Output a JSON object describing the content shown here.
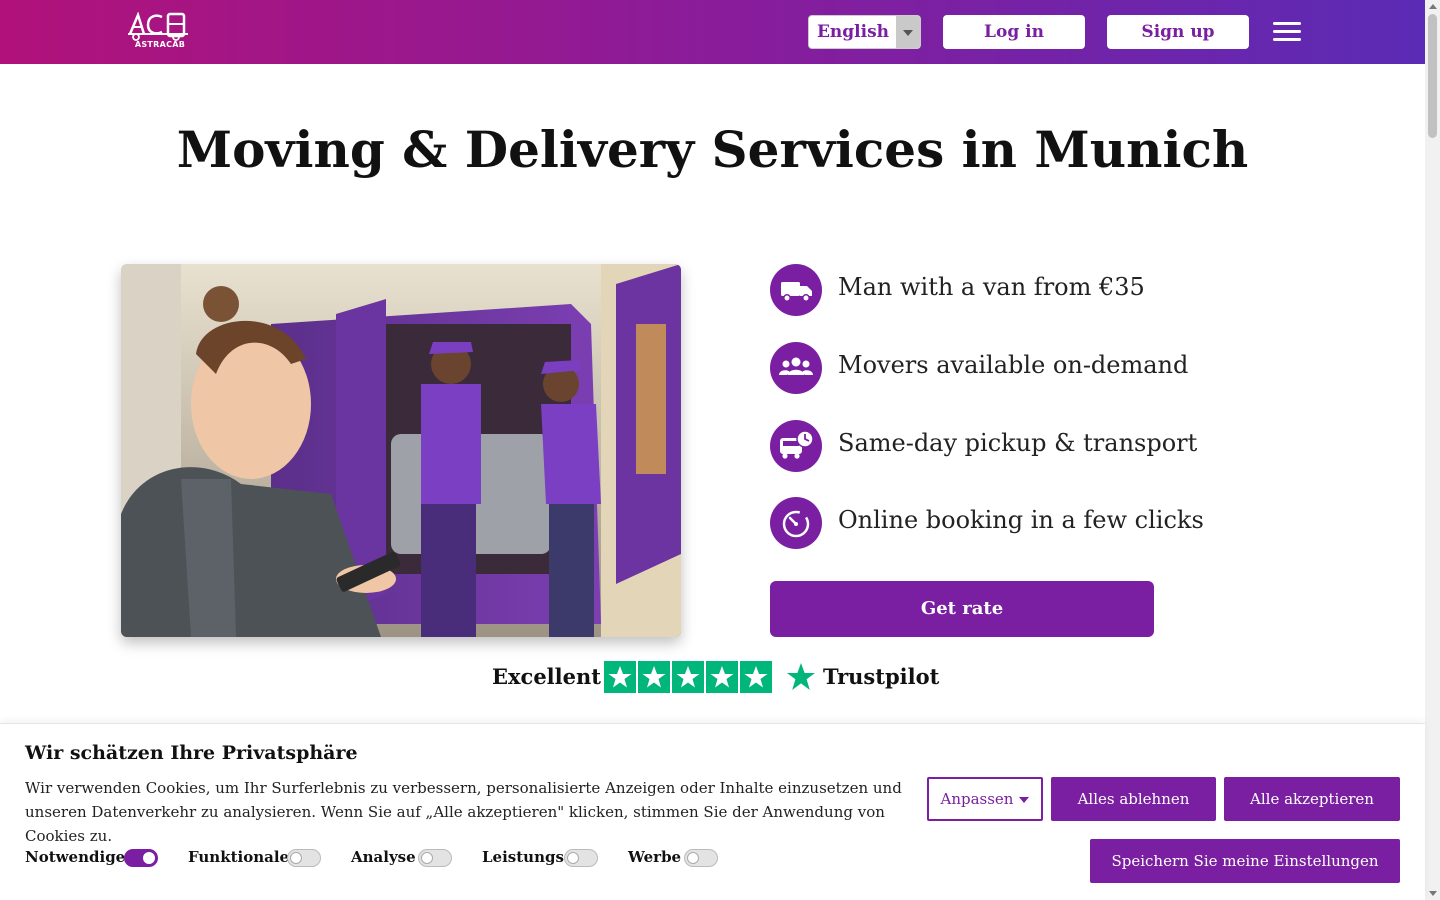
{
  "header": {
    "logo_text": "ASTRACAB",
    "language": "English",
    "login_label": "Log in",
    "signup_label": "Sign up"
  },
  "hero": {
    "title": "Moving & Delivery Services in Munich",
    "features": [
      {
        "icon": "truck-icon",
        "text": "Man with a van from €35"
      },
      {
        "icon": "people-icon",
        "text": "Movers available on-demand"
      },
      {
        "icon": "truck-clock-icon",
        "text": "Same-day pickup & transport"
      },
      {
        "icon": "stopwatch-icon",
        "text": "Online booking in a few clicks"
      }
    ],
    "cta_label": "Get rate"
  },
  "trustpilot": {
    "rating_text": "Excellent",
    "stars": 5,
    "brand": "Trustpilot"
  },
  "cookie": {
    "title": "Wir schätzen Ihre Privatsphäre",
    "text": "Wir verwenden Cookies, um Ihr Surferlebnis zu verbessern, personalisierte Anzeigen oder Inhalte einzusetzen und unseren Datenverkehr zu analysieren. Wenn Sie auf „Alle akzeptieren\" klicken, stimmen Sie der Anwendung von Cookies zu.",
    "customize_label": "Anpassen",
    "reject_label": "Alles ablehnen",
    "accept_label": "Alle akzeptieren",
    "save_label": "Speichern Sie meine Einstellungen",
    "toggles": [
      {
        "label": "Notwendige",
        "on": true
      },
      {
        "label": "Funktionale",
        "on": false
      },
      {
        "label": "Analyse",
        "on": false
      },
      {
        "label": "Leistungs",
        "on": false
      },
      {
        "label": "Werbe",
        "on": false
      }
    ]
  },
  "colors": {
    "brand": "#7b1fa2",
    "trustpilot_green": "#00b67a"
  }
}
